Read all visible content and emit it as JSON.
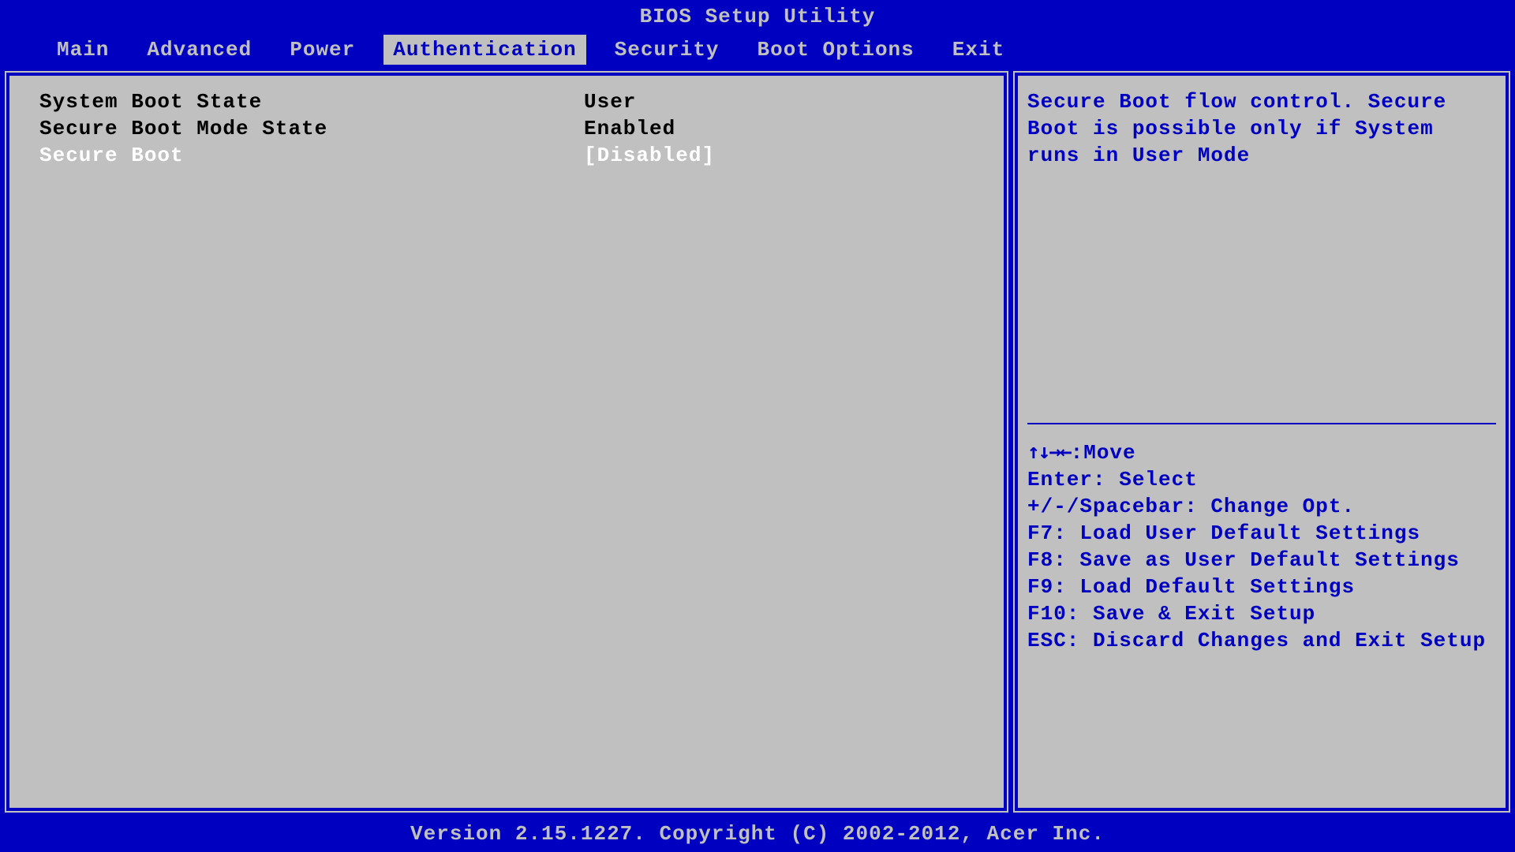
{
  "title": "BIOS Setup Utility",
  "menu": {
    "items": [
      {
        "label": "Main",
        "active": false
      },
      {
        "label": "Advanced",
        "active": false
      },
      {
        "label": "Power",
        "active": false
      },
      {
        "label": "Authentication",
        "active": true
      },
      {
        "label": "Security",
        "active": false
      },
      {
        "label": "Boot Options",
        "active": false
      },
      {
        "label": "Exit",
        "active": false
      }
    ]
  },
  "settings": [
    {
      "label": "System Boot State",
      "value": "User",
      "selected": false
    },
    {
      "label": "Secure Boot Mode State",
      "value": "Enabled",
      "selected": false
    },
    {
      "label": "Secure Boot",
      "value": "[Disabled]",
      "selected": true
    }
  ],
  "help": {
    "text": "Secure Boot flow control. Secure Boot is possible only if System runs in User Mode"
  },
  "keyhints": {
    "arrows": "↑↓→←",
    "move": ":Move",
    "enter": "Enter: Select",
    "change": "+/-/Spacebar: Change Opt.",
    "f7": "F7: Load User Default Settings",
    "f8": "F8: Save as User Default Settings",
    "f9": "F9: Load Default Settings",
    "f10": "F10: Save & Exit Setup",
    "esc": "ESC: Discard Changes and Exit Setup"
  },
  "footer": "Version 2.15.1227. Copyright (C) 2002-2012, Acer Inc."
}
